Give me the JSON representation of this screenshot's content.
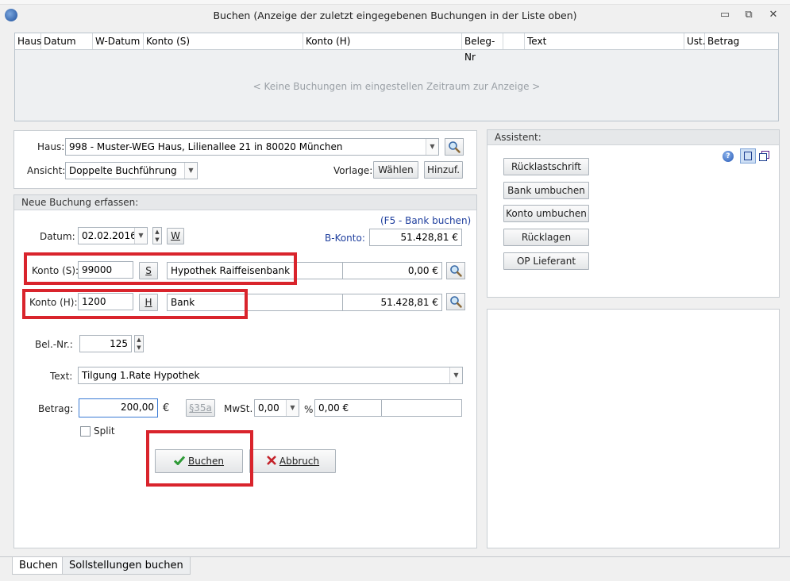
{
  "window": {
    "title": "Buchen (Anzeige der zuletzt eingegebenen Buchungen in der Liste oben)",
    "minimize_glyph": "▭",
    "restore_glyph": "⧉",
    "close_glyph": "✕"
  },
  "list": {
    "columns": [
      "Haus",
      "Datum",
      "W-Datum",
      "Konto (S)",
      "Konto (H)",
      "Beleg-Nr",
      "",
      "Text",
      "Ust.",
      "Betrag"
    ],
    "empty_message": "< Keine Buchungen im eingestellen Zeitraum zur Anzeige >"
  },
  "top_form": {
    "haus_label": "Haus:",
    "haus_value": "998 - Muster-WEG Haus, Lilienallee 21 in 80020 München",
    "ansicht_label": "Ansicht:",
    "ansicht_value": "Doppelte Buchführung",
    "vorlage_label": "Vorlage:",
    "waehlen_label": "Wählen",
    "hinzuf_label": "Hinzuf."
  },
  "booking": {
    "group_title": "Neue Buchung erfassen:",
    "hotkey_hint": "(F5 - Bank buchen)",
    "datum_label": "Datum:",
    "datum_value": "02.02.2016",
    "w_label": "W",
    "bkonto_label": "B-Konto:",
    "bkonto_value": "51.428,81 €",
    "konto_s_label": "Konto (S):",
    "konto_s_value": "99000",
    "s_btn": "S",
    "konto_s_name": "Hypothek Raiffeisenbank",
    "konto_s_amount": "0,00 €",
    "konto_h_label": "Konto (H):",
    "konto_h_value": "1200",
    "h_btn": "H",
    "konto_h_name": "Bank",
    "konto_h_amount": "51.428,81 €",
    "belnr_label": "Bel.-Nr.:",
    "belnr_value": "125",
    "text_label": "Text:",
    "text_value": "Tilgung 1.Rate Hypothek",
    "betrag_label": "Betrag:",
    "betrag_value": "200,00",
    "currency": "€",
    "paragraph_btn": "§35a",
    "mwst_label": "MwSt.",
    "mwst_value": "0,00",
    "percent": "%",
    "mwst_amount": "0,00 €",
    "split_label": "Split",
    "buchen_label": "Buchen",
    "abbruch_label": "Abbruch"
  },
  "assistant": {
    "title": "Assistent:",
    "buttons": [
      "Rücklastschrift",
      "Bank umbuchen",
      "Konto umbuchen",
      "Rücklagen",
      "OP Lieferant"
    ]
  },
  "tabs": [
    "Buchen",
    "Sollstellungen buchen"
  ],
  "colors": {
    "highlight_red": "#d9242c",
    "accent_blue": "#1f3f9e",
    "check_green": "#2e9a36",
    "cross_red": "#c4222a"
  }
}
